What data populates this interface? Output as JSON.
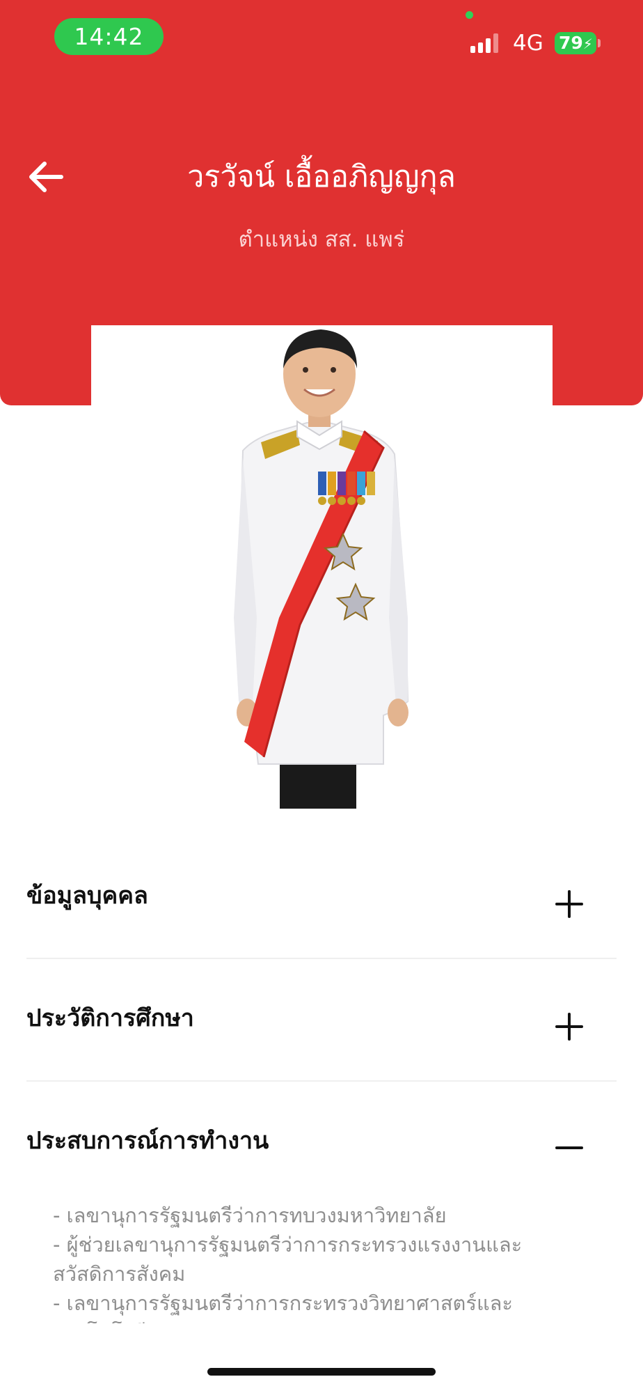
{
  "status_bar": {
    "time": "14:42",
    "network": "4G",
    "battery": "79"
  },
  "header": {
    "name": "วรวัจน์ เอื้ออภิญญกุล",
    "position": "ตำแหน่ง สส. แพร่"
  },
  "profile_photo": {
    "subject": "official portrait in white ceremonial uniform with red sash"
  },
  "sections": [
    {
      "title": "ข้อมูลบุคคล",
      "state": "collapsed",
      "toggle_icon": "plus-icon"
    },
    {
      "title": "ประวัติการศึกษา",
      "state": "collapsed",
      "toggle_icon": "plus-icon"
    },
    {
      "title": "ประสบการณ์การทำงาน",
      "state": "expanded",
      "toggle_icon": "minus-icon"
    }
  ],
  "work_experience": [
    "- เลขานุการรัฐมนตรีว่าการทบวงมหาวิทยาลัย",
    "- ผู้ช่วยเลขานุการรัฐมนตรีว่าการกระทรวงแรงงานและสวัสดิการสังคม",
    "- เลขานุการรัฐมนตรีว่าการกระทรวงวิทยาศาสตร์และเทคโนโลยี"
  ],
  "colors": {
    "header_red": "#e03131",
    "status_green": "#2fc84f"
  }
}
